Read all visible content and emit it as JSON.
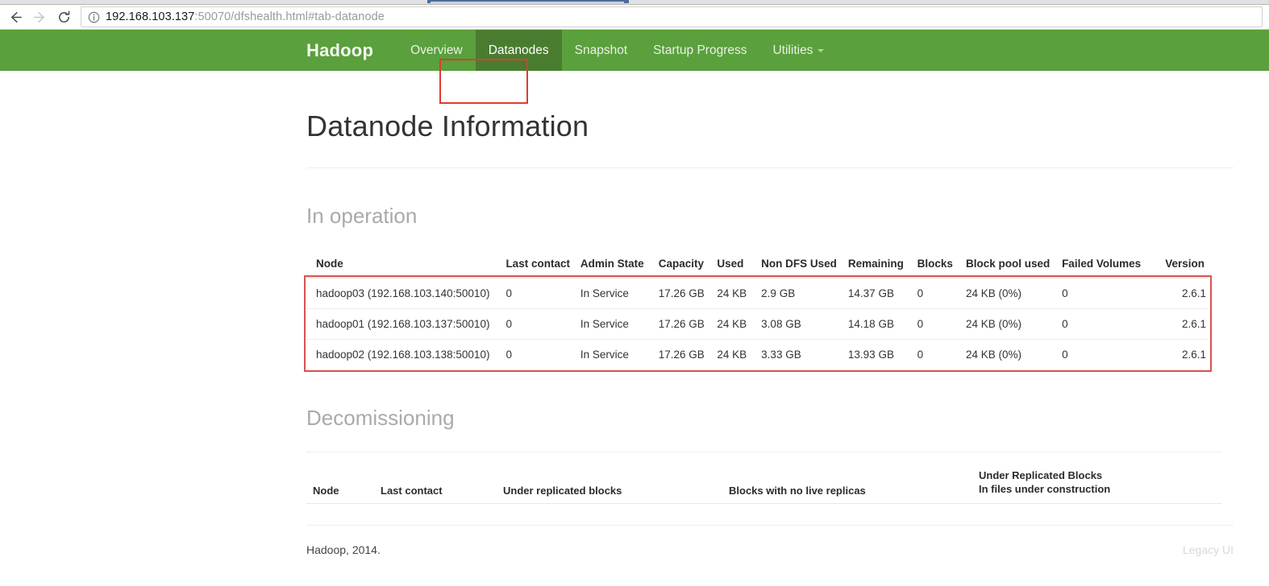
{
  "browser": {
    "back_icon": "arrow-left-icon",
    "forward_icon": "arrow-right-icon",
    "reload_icon": "reload-icon",
    "site_info_icon": "info-circle-icon",
    "url_host": "192.168.103.137",
    "url_rest": ":50070/dfshealth.html#tab-datanode",
    "url_full": "192.168.103.137:50070/dfshealth.html#tab-datanode"
  },
  "navbar": {
    "brand": "Hadoop",
    "accent_color": "#5aa03c",
    "active_color": "#4a7c2f",
    "items": [
      {
        "label": "Overview",
        "active": false
      },
      {
        "label": "Datanodes",
        "active": true
      },
      {
        "label": "Snapshot",
        "active": false
      },
      {
        "label": "Startup Progress",
        "active": false
      },
      {
        "label": "Utilities",
        "active": false,
        "has_caret": true
      }
    ]
  },
  "annotations": {
    "color": "#d9534f",
    "tab_highlight": "Datanodes",
    "rows_highlight": "in-operation-table-rows"
  },
  "page": {
    "title": "Datanode Information"
  },
  "in_operation": {
    "heading": "In operation",
    "columns": [
      "Node",
      "Last contact",
      "Admin State",
      "Capacity",
      "Used",
      "Non DFS Used",
      "Remaining",
      "Blocks",
      "Block pool used",
      "Failed Volumes",
      "Version"
    ],
    "rows": [
      {
        "node": "hadoop03 (192.168.103.140:50010)",
        "last_contact": "0",
        "admin_state": "In Service",
        "capacity": "17.26 GB",
        "used": "24 KB",
        "non_dfs_used": "2.9 GB",
        "remaining": "14.37 GB",
        "blocks": "0",
        "block_pool_used": "24 KB (0%)",
        "failed_volumes": "0",
        "version": "2.6.1"
      },
      {
        "node": "hadoop01 (192.168.103.137:50010)",
        "last_contact": "0",
        "admin_state": "In Service",
        "capacity": "17.26 GB",
        "used": "24 KB",
        "non_dfs_used": "3.08 GB",
        "remaining": "14.18 GB",
        "blocks": "0",
        "block_pool_used": "24 KB (0%)",
        "failed_volumes": "0",
        "version": "2.6.1"
      },
      {
        "node": "hadoop02 (192.168.103.138:50010)",
        "last_contact": "0",
        "admin_state": "In Service",
        "capacity": "17.26 GB",
        "used": "24 KB",
        "non_dfs_used": "3.33 GB",
        "remaining": "13.93 GB",
        "blocks": "0",
        "block_pool_used": "24 KB (0%)",
        "failed_volumes": "0",
        "version": "2.6.1"
      }
    ]
  },
  "decommissioning": {
    "heading": "Decomissioning",
    "columns": [
      "Node",
      "Last contact",
      "Under replicated blocks",
      "Blocks with no live replicas",
      "Under Replicated Blocks",
      "In files under construction"
    ],
    "rows": []
  },
  "footer": {
    "copyright": "Hadoop, 2014.",
    "legacy_link": "Legacy UI"
  }
}
